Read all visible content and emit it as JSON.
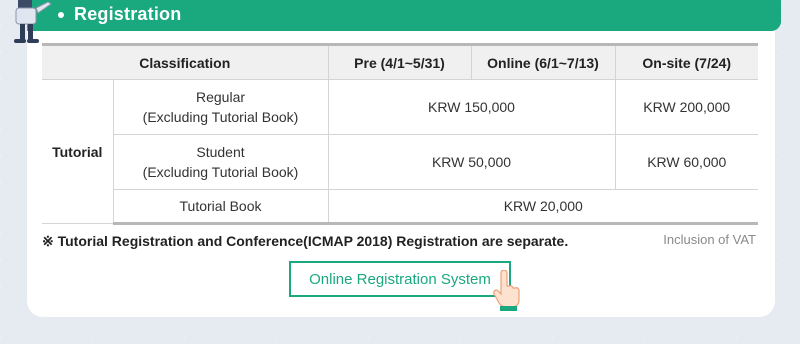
{
  "header": {
    "title": "Registration"
  },
  "table": {
    "headers": [
      "Classification",
      "Pre (4/1~5/31)",
      "Online (6/1~7/13)",
      "On-site (7/24)"
    ],
    "group_label": "Tutorial",
    "rows": [
      {
        "name_line1": "Regular",
        "name_line2": "(Excluding Tutorial Book)",
        "pre_online": "KRW 150,000",
        "onsite": "KRW 200,000"
      },
      {
        "name_line1": "Student",
        "name_line2": "(Excluding Tutorial Book)",
        "pre_online": "KRW 50,000",
        "onsite": "KRW 60,000"
      },
      {
        "name": "Tutorial Book",
        "price": "KRW 20,000"
      }
    ]
  },
  "note": "※ Tutorial Registration and Conference(ICMAP 2018) Registration are separate.",
  "vat_note": "Inclusion of VAT",
  "button": {
    "label": "Online Registration System"
  },
  "icons": {
    "mascot": "person-mascot-icon",
    "pointer": "pointing-hand-icon",
    "bullet": "bullet-dot-icon"
  },
  "colors": {
    "accent": "#1aa87f",
    "background": "#e6ebf1",
    "table_header_bg": "#f0f0f0"
  }
}
